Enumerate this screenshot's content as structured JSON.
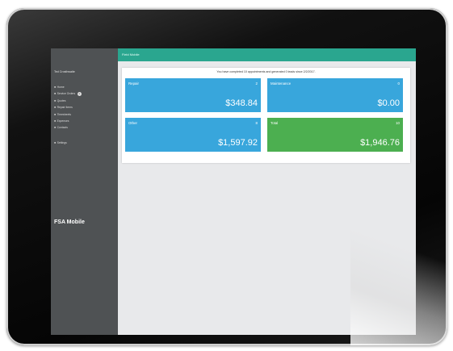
{
  "sidebar": {
    "user_name": "Ted Crosthwaite",
    "items": [
      {
        "icon": "home-icon",
        "label": "Home",
        "badge": ""
      },
      {
        "icon": "service-orders-icon",
        "label": "Service Orders",
        "badge": "1"
      },
      {
        "icon": "quotes-icon",
        "label": "Quotes",
        "badge": ""
      },
      {
        "icon": "repair-items-icon",
        "label": "Repair Items",
        "badge": ""
      },
      {
        "icon": "timesheets-icon",
        "label": "Timesheets",
        "badge": ""
      },
      {
        "icon": "expenses-icon",
        "label": "Expenses",
        "badge": ""
      },
      {
        "icon": "contacts-icon",
        "label": "Contacts",
        "badge": ""
      },
      {
        "icon": "settings-icon",
        "label": "Settings",
        "badge": ""
      }
    ],
    "brand": "FSA Mobile"
  },
  "header": {
    "title": "Field Mobile"
  },
  "dashboard": {
    "notice": "You have completed 10 appointments and generated 0 leads since 2/2/2017.",
    "cards": [
      {
        "label": "Repair",
        "count": "2",
        "amount": "$348.84",
        "color": "#38a6dc"
      },
      {
        "label": "Maintenance",
        "count": "0",
        "amount": "$0.00",
        "color": "#38a6dc"
      },
      {
        "label": "Other",
        "count": "8",
        "amount": "$1,597.92",
        "color": "#38a6dc"
      },
      {
        "label": "Total",
        "count": "10",
        "amount": "$1,946.76",
        "color": "#4caf50"
      }
    ]
  }
}
